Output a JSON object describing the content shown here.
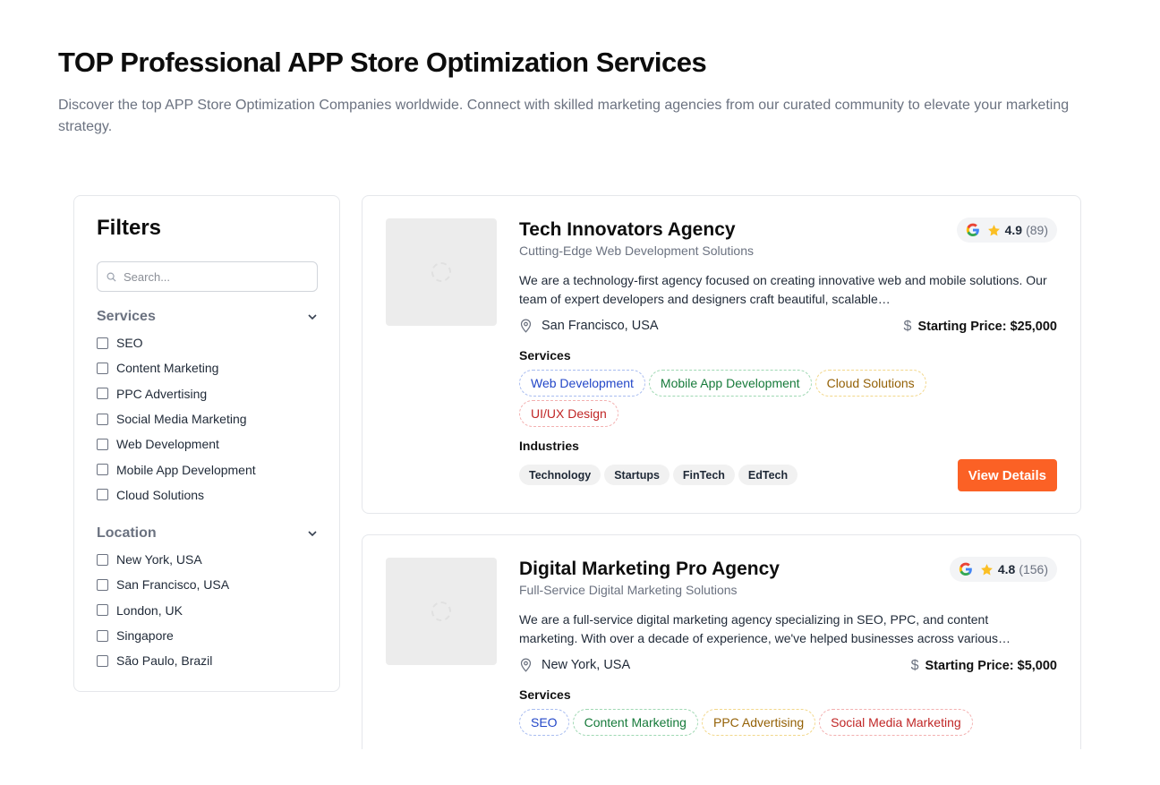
{
  "header": {
    "title": "TOP Professional APP Store Optimization Services",
    "description": "Discover the top APP Store Optimization Companies worldwide. Connect with skilled marketing agencies from our curated community to elevate your marketing strategy."
  },
  "filters": {
    "title": "Filters",
    "search_placeholder": "Search...",
    "services": {
      "label": "Services",
      "options": [
        "SEO",
        "Content Marketing",
        "PPC Advertising",
        "Social Media Marketing",
        "Web Development",
        "Mobile App Development",
        "Cloud Solutions"
      ]
    },
    "location": {
      "label": "Location",
      "options": [
        "New York, USA",
        "San Francisco, USA",
        "London, UK",
        "Singapore",
        "São Paulo, Brazil"
      ]
    }
  },
  "agencies": [
    {
      "name": "Tech Innovators Agency",
      "tagline": "Cutting-Edge Web Development Solutions",
      "rating": "4.9",
      "reviews": "(89)",
      "description": "We are a technology-first agency focused on creating innovative web and mobile solutions. Our team of expert developers and designers craft beautiful, scalable…",
      "location": "San Francisco, USA",
      "price": "Starting Price: $25,000",
      "services_label": "Services",
      "services": [
        "Web Development",
        "Mobile App Development",
        "Cloud Solutions",
        "UI/UX Design"
      ],
      "industries_label": "Industries",
      "industries": [
        "Technology",
        "Startups",
        "FinTech",
        "EdTech"
      ],
      "cta": "View Details"
    },
    {
      "name": "Digital Marketing Pro Agency",
      "tagline": "Full-Service Digital Marketing Solutions",
      "rating": "4.8",
      "reviews": "(156)",
      "description": "We are a full-service digital marketing agency specializing in SEO, PPC, and content marketing. With over a decade of experience, we've helped businesses across various…",
      "location": "New York, USA",
      "price": "Starting Price: $5,000",
      "services_label": "Services",
      "services": [
        "SEO",
        "Content Marketing",
        "PPC Advertising",
        "Social Media Marketing"
      ]
    }
  ],
  "pill_colors": [
    "blue",
    "green",
    "yellow",
    "red"
  ],
  "colors": {
    "accent": "#fb6125",
    "star": "#fbbf24"
  }
}
